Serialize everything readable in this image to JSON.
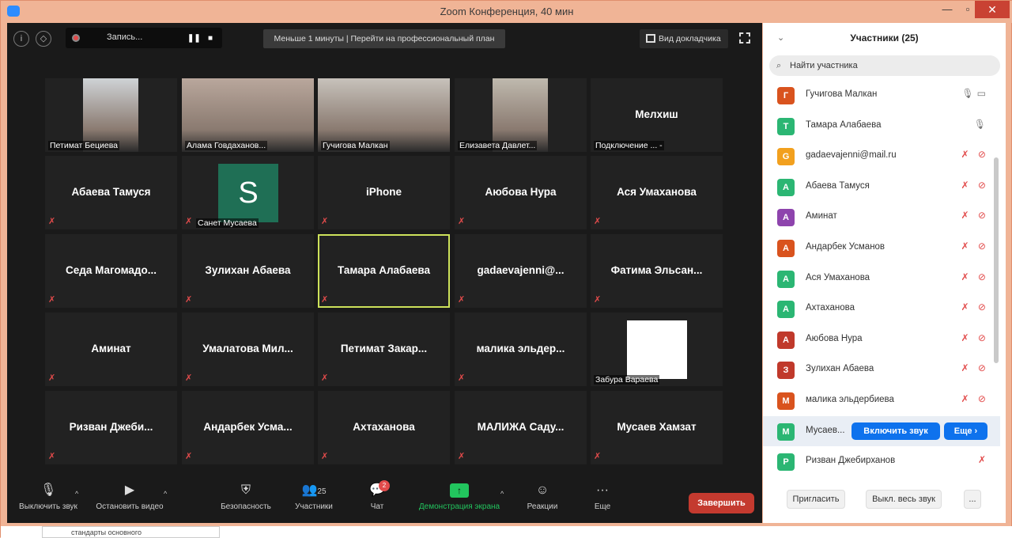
{
  "window": {
    "title": "Zoom Конференция, 40 мин"
  },
  "topbar": {
    "recording_label": "Запись...",
    "banner": "Меньше 1 минуты | Перейти на профессиональный план",
    "view_label": "Вид докладчика"
  },
  "tiles": [
    {
      "name": "Петимат Бециева",
      "kind": "video"
    },
    {
      "name": "Алама Говдаханов...",
      "kind": "video"
    },
    {
      "name": "Гучигова Малкан",
      "kind": "video"
    },
    {
      "name": "Елизавета Давлет...",
      "kind": "video"
    },
    {
      "name": "Мелхиш",
      "kind": "name",
      "sub": "Подключение ... -"
    },
    {
      "name": "Абаева Тамуся",
      "kind": "name"
    },
    {
      "name": "Санет Мусаева",
      "kind": "avatar",
      "initial": "S"
    },
    {
      "name": "iPhone",
      "kind": "name"
    },
    {
      "name": "Аюбова Нура",
      "kind": "name"
    },
    {
      "name": "Ася Умаханова",
      "kind": "name"
    },
    {
      "name": "Седа  Магомадо...",
      "kind": "name"
    },
    {
      "name": "Зулихан Абаева",
      "kind": "name"
    },
    {
      "name": "Тамара Алабаева",
      "kind": "name",
      "active": true
    },
    {
      "name": "gadaevajenni@...",
      "kind": "name"
    },
    {
      "name": "Фатима  Эльсан...",
      "kind": "name"
    },
    {
      "name": "Аминат",
      "kind": "name"
    },
    {
      "name": "Умалатова  Мил...",
      "kind": "name"
    },
    {
      "name": "Петимат  Закар...",
      "kind": "name"
    },
    {
      "name": "малика  эльдер...",
      "kind": "name"
    },
    {
      "name": "Забура Вараева",
      "kind": "white"
    },
    {
      "name": "Ризван  Джеби...",
      "kind": "name"
    },
    {
      "name": "Андарбек  Усма...",
      "kind": "name"
    },
    {
      "name": "Ахтаханова",
      "kind": "name"
    },
    {
      "name": "МАЛИЖА  Саду...",
      "kind": "name"
    },
    {
      "name": "Мусаев Хамзат",
      "kind": "name"
    }
  ],
  "toolbar": {
    "mute": "Выключить звук",
    "video": "Остановить видео",
    "security": "Безопасность",
    "participants": "Участники",
    "participants_count": "25",
    "chat": "Чат",
    "chat_badge": "2",
    "share": "Демонстрация экрана",
    "reactions": "Реакции",
    "more": "Еще",
    "end": "Завершить"
  },
  "panel": {
    "title": "Участники (25)",
    "search_placeholder": "Найти участника",
    "participants": [
      {
        "initial": "Г",
        "name": "Гучигова Малкан",
        "color": "#d9531e",
        "status": "on"
      },
      {
        "initial": "Т",
        "name": "Тамара Алабаева",
        "color": "#2bb673",
        "status": "mic"
      },
      {
        "initial": "G",
        "name": "gadaevajenni@mail.ru",
        "color": "#f2a01e",
        "status": "off"
      },
      {
        "initial": "А",
        "name": "Абаева Тамуся",
        "color": "#2bb673",
        "status": "off"
      },
      {
        "initial": "А",
        "name": "Аминат",
        "color": "#8e44ad",
        "status": "off"
      },
      {
        "initial": "А",
        "name": "Андарбек Усманов",
        "color": "#d9531e",
        "status": "off"
      },
      {
        "initial": "А",
        "name": "Ася Умаханова",
        "color": "#2bb673",
        "status": "off"
      },
      {
        "initial": "А",
        "name": "Ахтаханова",
        "color": "#2bb673",
        "status": "off"
      },
      {
        "initial": "А",
        "name": "Аюбова Нура",
        "color": "#c0392b",
        "status": "off"
      },
      {
        "initial": "З",
        "name": "Зулихан Абаева",
        "color": "#c0392b",
        "status": "off"
      },
      {
        "initial": "М",
        "name": "малика эльдербиева",
        "color": "#d9531e",
        "status": "off"
      },
      {
        "initial": "М",
        "name": "Мусаев...",
        "color": "#2bb673",
        "status": "buttons"
      },
      {
        "initial": "Р",
        "name": "Ризван Джебирханов",
        "color": "#2bb673",
        "status": "micoff"
      }
    ],
    "unmute_btn": "Включить звук",
    "more_btn": "Еще ›",
    "invite": "Пригласить",
    "mute_all": "Выкл. весь звук",
    "dots": "..."
  },
  "below": {
    "doc_label": "стандарты основного"
  }
}
